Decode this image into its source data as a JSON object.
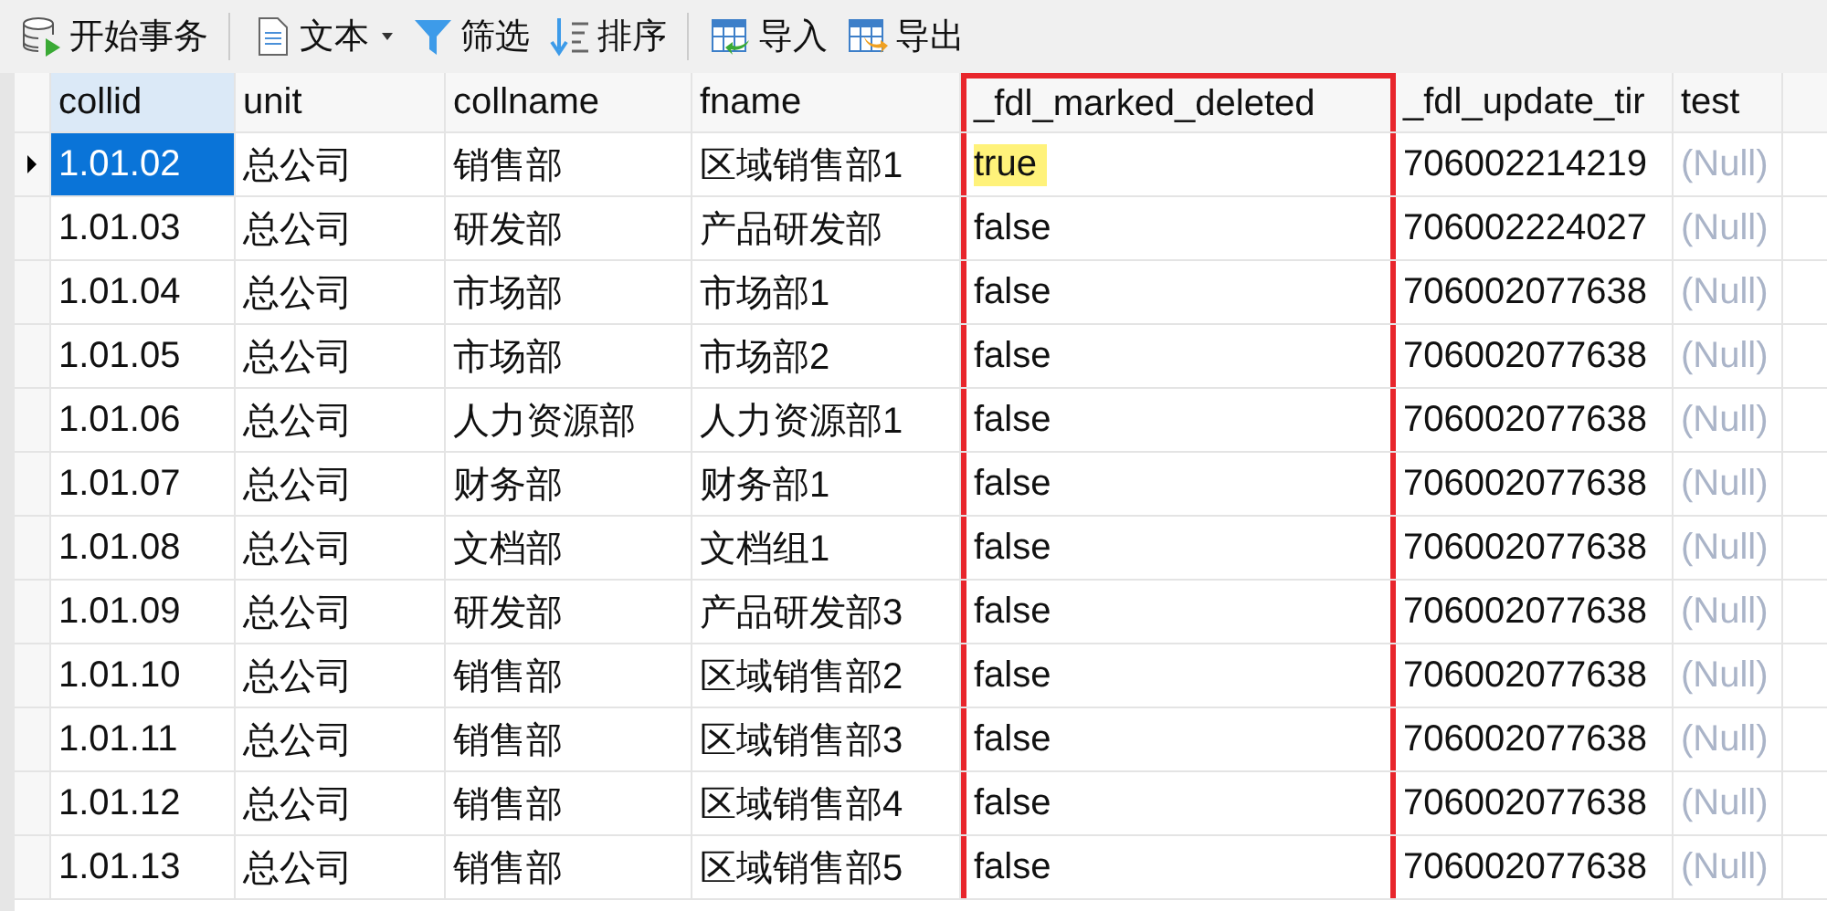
{
  "toolbar": [
    {
      "kind": "transaction",
      "label": "开始事务"
    },
    {
      "kind": "text",
      "label": "文本",
      "dropdown": true
    },
    {
      "kind": "filter",
      "label": "筛选"
    },
    {
      "kind": "sort",
      "label": "排序"
    },
    {
      "kind": "import",
      "label": "导入"
    },
    {
      "kind": "export",
      "label": "导出"
    }
  ],
  "table": {
    "columns": [
      {
        "label": "collid",
        "highlighted": false
      },
      {
        "label": "unit",
        "highlighted": false
      },
      {
        "label": "collname",
        "highlighted": false
      },
      {
        "label": "fname",
        "highlighted": false
      },
      {
        "label": "_fdl_marked_deleted",
        "highlighted": true
      },
      {
        "label": "_fdl_update_tir",
        "highlighted": false
      },
      {
        "label": "test",
        "highlighted": false
      }
    ],
    "rows": [
      {
        "selected": true,
        "cells": [
          "1.01.02",
          "总公司",
          "销售部",
          "区域销售部1",
          "true",
          "706002214219",
          "(Null)"
        ]
      },
      {
        "selected": false,
        "cells": [
          "1.01.03",
          "总公司",
          "研发部",
          "产品研发部",
          "false",
          "706002224027",
          "(Null)"
        ]
      },
      {
        "selected": false,
        "cells": [
          "1.01.04",
          "总公司",
          "市场部",
          "市场部1",
          "false",
          "706002077638",
          "(Null)"
        ]
      },
      {
        "selected": false,
        "cells": [
          "1.01.05",
          "总公司",
          "市场部",
          "市场部2",
          "false",
          "706002077638",
          "(Null)"
        ]
      },
      {
        "selected": false,
        "cells": [
          "1.01.06",
          "总公司",
          "人力资源部",
          "人力资源部1",
          "false",
          "706002077638",
          "(Null)"
        ]
      },
      {
        "selected": false,
        "cells": [
          "1.01.07",
          "总公司",
          "财务部",
          "财务部1",
          "false",
          "706002077638",
          "(Null)"
        ]
      },
      {
        "selected": false,
        "cells": [
          "1.01.08",
          "总公司",
          "文档部",
          "文档组1",
          "false",
          "706002077638",
          "(Null)"
        ]
      },
      {
        "selected": false,
        "cells": [
          "1.01.09",
          "总公司",
          "研发部",
          "产品研发部3",
          "false",
          "706002077638",
          "(Null)"
        ]
      },
      {
        "selected": false,
        "cells": [
          "1.01.10",
          "总公司",
          "销售部",
          "区域销售部2",
          "false",
          "706002077638",
          "(Null)"
        ]
      },
      {
        "selected": false,
        "cells": [
          "1.01.11",
          "总公司",
          "销售部",
          "区域销售部3",
          "false",
          "706002077638",
          "(Null)"
        ]
      },
      {
        "selected": false,
        "cells": [
          "1.01.12",
          "总公司",
          "销售部",
          "区域销售部4",
          "false",
          "706002077638",
          "(Null)"
        ]
      },
      {
        "selected": false,
        "cells": [
          "1.01.13",
          "总公司",
          "销售部",
          "区域销售部5",
          "false",
          "706002077638",
          "(Null)"
        ]
      }
    ]
  }
}
